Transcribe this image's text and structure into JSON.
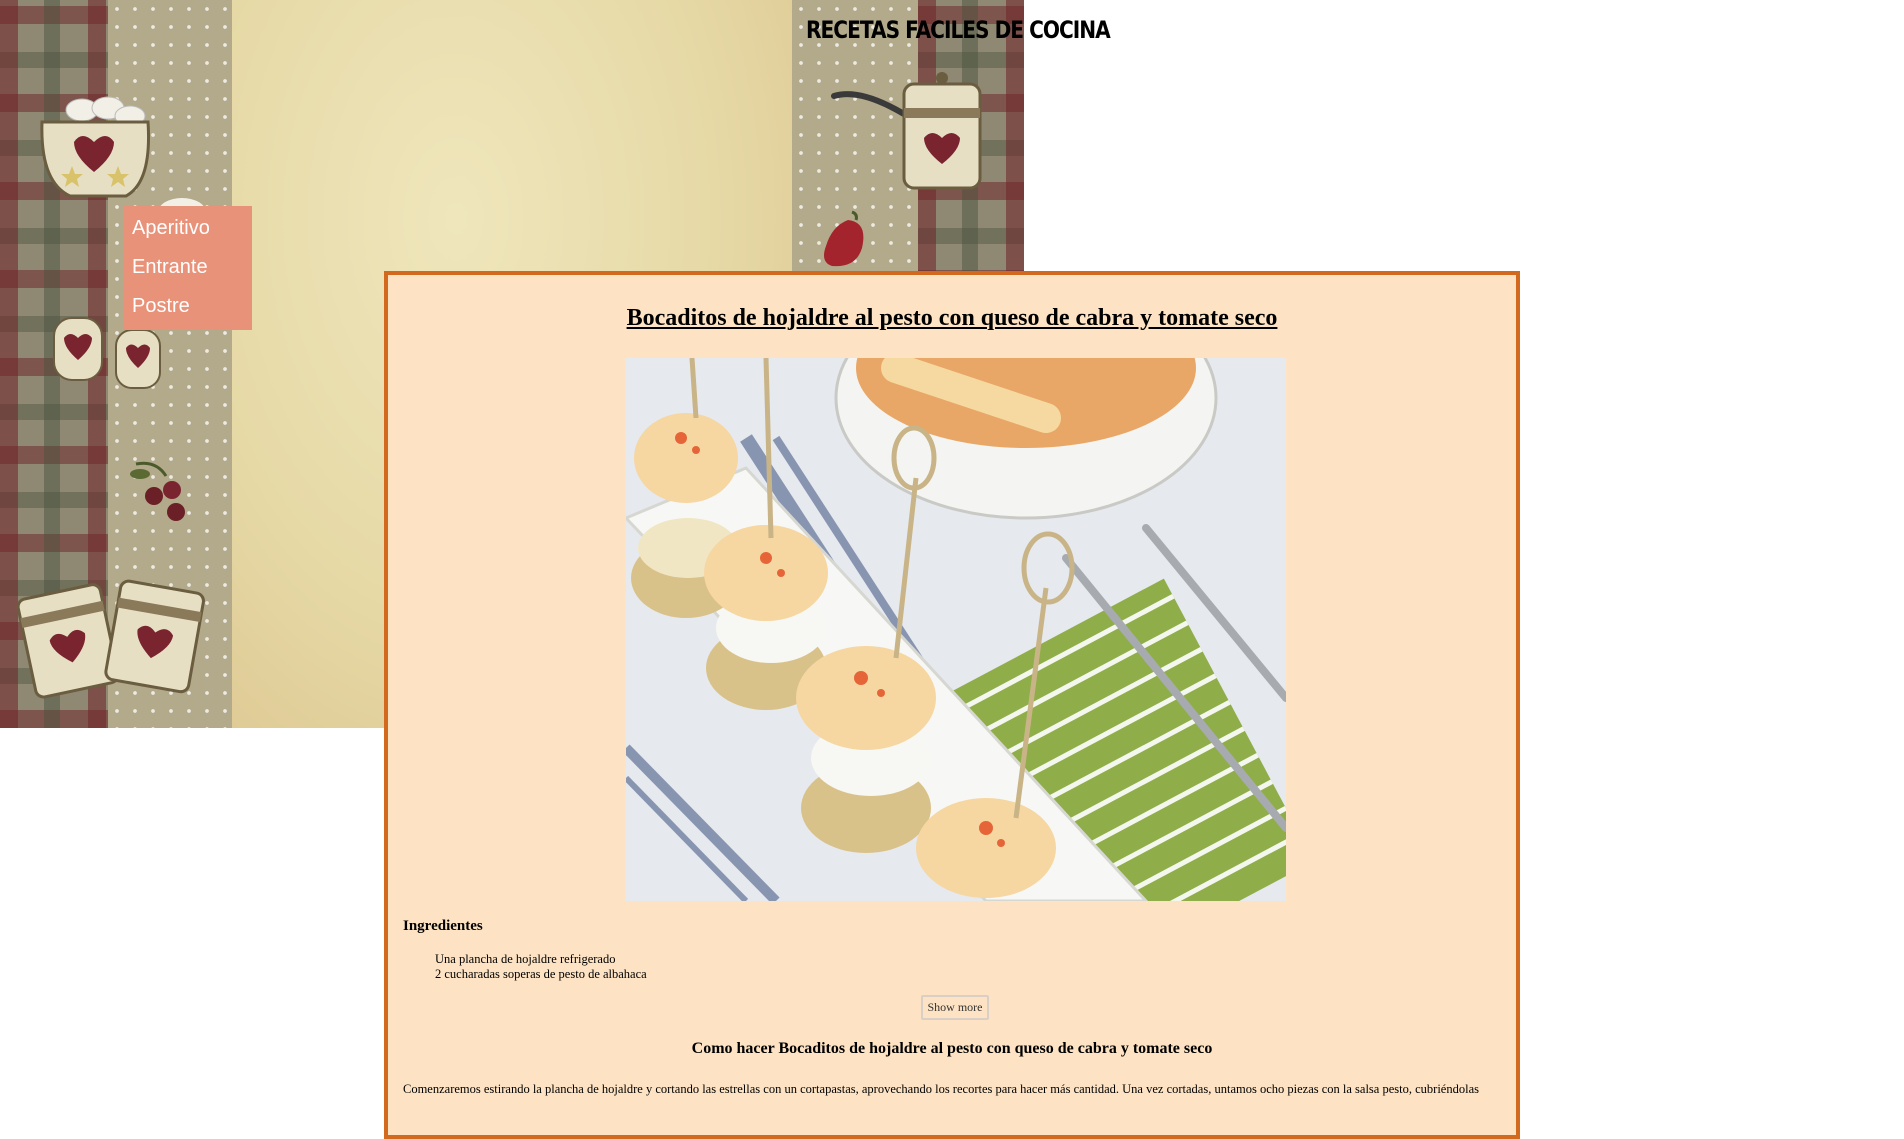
{
  "site": {
    "title": "RECETAS FACILES DE COCINA"
  },
  "menu": {
    "items": [
      {
        "label": "Aperitivo"
      },
      {
        "label": "Entrante"
      },
      {
        "label": "Postre"
      }
    ]
  },
  "recipe": {
    "title": "Bocaditos de hojaldre al pesto con queso de cabra y tomate seco",
    "ingredients_heading": "Ingredientes",
    "ingredients": [
      "Una plancha de hojaldre refrigerado",
      "2 cucharadas soperas de pesto de albahaca"
    ],
    "show_more_label": "Show more",
    "method_heading": "Como hacer Bocaditos de hojaldre al pesto con queso de cabra y tomate seco",
    "method_text": "Comenzaremos estirando la plancha de hojaldre y cortando las estrellas con un cortapastas, aprovechando los recortes para hacer más cantidad. Una vez cortadas, untamos ocho piezas con la salsa pesto, cubriéndolas"
  },
  "colors": {
    "menu_background": "#e8927a",
    "card_background": "#fde3c3",
    "card_border": "#d2691e"
  }
}
